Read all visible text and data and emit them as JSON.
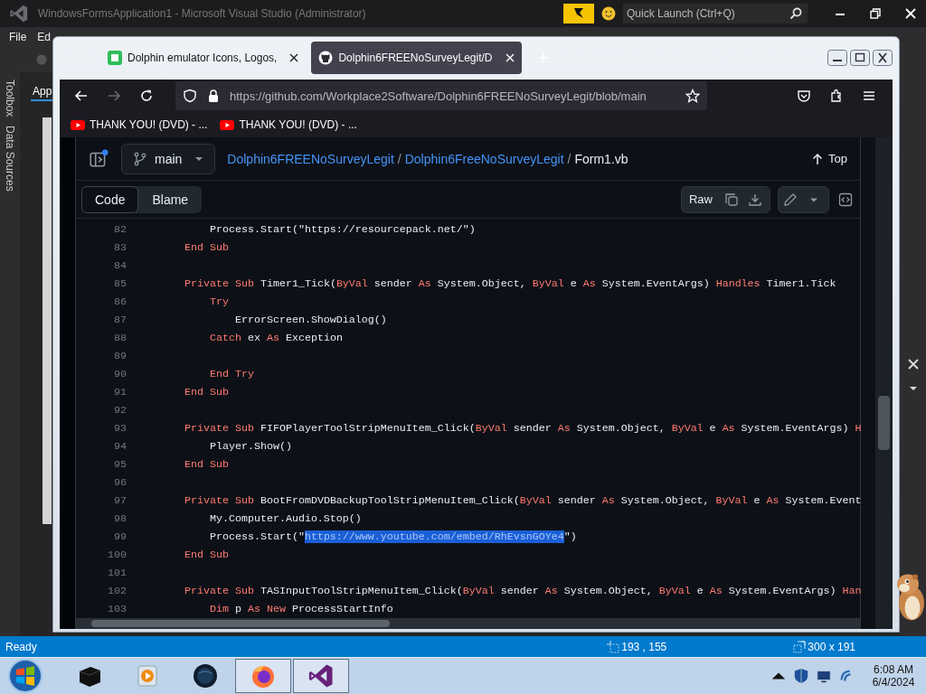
{
  "ide": {
    "title": "WindowsFormsApplication1 - Microsoft Visual Studio (Administrator)",
    "quick_launch": {
      "placeholder": "Quick Launch (Ctrl+Q)"
    },
    "menu": [
      "File",
      "Ed"
    ],
    "side_tabs": [
      "Toolbox",
      "Data Sources"
    ],
    "doc_tab": "App"
  },
  "browser": {
    "tabs": [
      {
        "title": "Dolphin emulator Icons, Logos,",
        "kind": "site",
        "selected": false
      },
      {
        "title": "Dolphin6FREENoSurveyLegit/D",
        "kind": "github",
        "selected": true
      }
    ],
    "url": "https://github.com/Workplace2Software/Dolphin6FREENoSurveyLegit/blob/main",
    "bookmarks": [
      "THANK YOU! (DVD) - ...",
      "THANK YOU! (DVD) - ..."
    ]
  },
  "file_header": {
    "branch": "main",
    "breadcrumbs": [
      {
        "text": "Dolphin6FREENoSurveyLegit",
        "kind": "link"
      },
      {
        "text": "/",
        "kind": "separator"
      },
      {
        "text": "Dolphin6FreeNoSurveyLegit",
        "kind": "link"
      },
      {
        "text": "/",
        "kind": "separator"
      },
      {
        "text": "Form1.vb",
        "kind": "current"
      }
    ],
    "top": "Top",
    "view_tabs": [
      {
        "label": "Code",
        "selected": true
      },
      {
        "label": "Blame",
        "selected": false
      }
    ],
    "raw": "Raw"
  },
  "code_lines": [
    {
      "number": "82",
      "tokens": [
        {
          "kind": "plain",
          "text": "        Process.Start(\"https://resourcepack.net/\")"
        }
      ]
    },
    {
      "number": "83",
      "tokens": [
        {
          "kind": "kw",
          "text": "    End Sub"
        }
      ]
    },
    {
      "number": "84"
    },
    {
      "number": "85",
      "tokens": [
        {
          "kind": "kw",
          "text": "    Private Sub"
        },
        {
          "kind": "plain",
          "text": " Timer1_Tick("
        },
        {
          "kind": "kw",
          "text": "ByVal"
        },
        {
          "kind": "plain",
          "text": " sender "
        },
        {
          "kind": "kw",
          "text": "As"
        },
        {
          "kind": "plain",
          "text": " System.Object, "
        },
        {
          "kind": "kw",
          "text": "ByVal"
        },
        {
          "kind": "plain",
          "text": " e "
        },
        {
          "kind": "kw",
          "text": "As"
        },
        {
          "kind": "plain",
          "text": " System.EventArgs) "
        },
        {
          "kind": "kw",
          "text": "Handles"
        },
        {
          "kind": "plain",
          "text": " Timer1.Tick"
        }
      ]
    },
    {
      "number": "86",
      "tokens": [
        {
          "kind": "kw",
          "text": "        Try"
        }
      ]
    },
    {
      "number": "87",
      "tokens": [
        {
          "kind": "plain",
          "text": "            ErrorScreen.ShowDialog()"
        }
      ]
    },
    {
      "number": "88",
      "tokens": [
        {
          "kind": "kw",
          "text": "        Catch"
        },
        {
          "kind": "plain",
          "text": " ex "
        },
        {
          "kind": "kw",
          "text": "As"
        },
        {
          "kind": "plain",
          "text": " Exception"
        }
      ]
    },
    {
      "number": "89"
    },
    {
      "number": "90",
      "tokens": [
        {
          "kind": "kw",
          "text": "        End Try"
        }
      ]
    },
    {
      "number": "91",
      "tokens": [
        {
          "kind": "kw",
          "text": "    End Sub"
        }
      ]
    },
    {
      "number": "92"
    },
    {
      "number": "93",
      "tokens": [
        {
          "kind": "kw",
          "text": "    Private Sub"
        },
        {
          "kind": "plain",
          "text": " FIFOPlayerToolStripMenuItem_Click("
        },
        {
          "kind": "kw",
          "text": "ByVal"
        },
        {
          "kind": "plain",
          "text": " sender "
        },
        {
          "kind": "kw",
          "text": "As"
        },
        {
          "kind": "plain",
          "text": " System.Object, "
        },
        {
          "kind": "kw",
          "text": "ByVal"
        },
        {
          "kind": "plain",
          "text": " e "
        },
        {
          "kind": "kw",
          "text": "As"
        },
        {
          "kind": "plain",
          "text": " System.EventArgs) "
        },
        {
          "kind": "kw",
          "text": "H"
        }
      ]
    },
    {
      "number": "94",
      "tokens": [
        {
          "kind": "plain",
          "text": "        Player.Show()"
        }
      ]
    },
    {
      "number": "95",
      "tokens": [
        {
          "kind": "kw",
          "text": "    End Sub"
        }
      ]
    },
    {
      "number": "96"
    },
    {
      "number": "97",
      "tokens": [
        {
          "kind": "kw",
          "text": "    Private Sub"
        },
        {
          "kind": "plain",
          "text": " BootFromDVDBackupToolStripMenuItem_Click("
        },
        {
          "kind": "kw",
          "text": "ByVal"
        },
        {
          "kind": "plain",
          "text": " sender "
        },
        {
          "kind": "kw",
          "text": "As"
        },
        {
          "kind": "plain",
          "text": " System.Object, "
        },
        {
          "kind": "kw",
          "text": "ByVal"
        },
        {
          "kind": "plain",
          "text": " e "
        },
        {
          "kind": "kw",
          "text": "As"
        },
        {
          "kind": "plain",
          "text": " System.Event"
        }
      ]
    },
    {
      "number": "98",
      "tokens": [
        {
          "kind": "plain",
          "text": "        My.Computer.Audio.Stop()"
        }
      ]
    },
    {
      "number": "99",
      "tokens": [
        {
          "kind": "plain",
          "text": "        Process.Start(\""
        },
        {
          "kind": "sel",
          "text": "https://www.youtube.com/embed/RhEvsnGOYe4"
        },
        {
          "kind": "plain",
          "text": "\")"
        }
      ]
    },
    {
      "number": "100",
      "tokens": [
        {
          "kind": "kw",
          "text": "    End Sub"
        }
      ]
    },
    {
      "number": "101"
    },
    {
      "number": "102",
      "tokens": [
        {
          "kind": "kw",
          "text": "    Private Sub"
        },
        {
          "kind": "plain",
          "text": " TASInputToolStripMenuItem_Click("
        },
        {
          "kind": "kw",
          "text": "ByVal"
        },
        {
          "kind": "plain",
          "text": " sender "
        },
        {
          "kind": "kw",
          "text": "As"
        },
        {
          "kind": "plain",
          "text": " System.Object, "
        },
        {
          "kind": "kw",
          "text": "ByVal"
        },
        {
          "kind": "plain",
          "text": " e "
        },
        {
          "kind": "kw",
          "text": "As"
        },
        {
          "kind": "plain",
          "text": " System.EventArgs) "
        },
        {
          "kind": "kw",
          "text": "Han"
        }
      ]
    },
    {
      "number": "103",
      "tokens": [
        {
          "kind": "kw",
          "text": "        Dim"
        },
        {
          "kind": "plain",
          "text": " p "
        },
        {
          "kind": "kw",
          "text": "As New"
        },
        {
          "kind": "plain",
          "text": " ProcessStartInfo"
        }
      ]
    }
  ],
  "status_bar": {
    "text": "Ready",
    "position": "193 , 155",
    "size": "300 x 191"
  },
  "taskbar": {
    "apps": [
      {
        "kind": "box",
        "active": false
      },
      {
        "kind": "player",
        "active": false
      },
      {
        "kind": "globe",
        "active": false
      },
      {
        "kind": "firefox",
        "active": true
      },
      {
        "kind": "vs",
        "active": true
      }
    ],
    "time": "6:08 AM",
    "date": "6/4/2024"
  }
}
